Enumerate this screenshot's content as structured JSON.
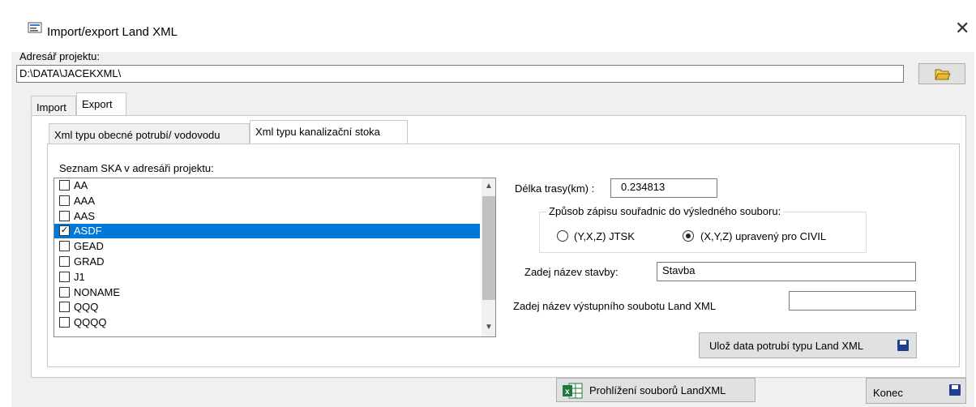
{
  "window": {
    "title": "Import/export Land XML",
    "close_symbol": "✕"
  },
  "project": {
    "dir_label": "Adresář projektu:",
    "dir_value": "D:\\DATA\\JACEKXML\\"
  },
  "main_tabs": {
    "import": "Import",
    "export": "Export"
  },
  "sub_tabs": {
    "general": "Xml typu obecné potrubí/ vodovodu",
    "sewer": "Xml typu kanalizační stoka"
  },
  "list": {
    "label": "Seznam SKA v adresáři projektu:",
    "items": [
      {
        "name": "AA",
        "checked": false,
        "selected": false
      },
      {
        "name": "AAA",
        "checked": false,
        "selected": false
      },
      {
        "name": "AAS",
        "checked": false,
        "selected": false
      },
      {
        "name": "ASDF",
        "checked": true,
        "selected": true
      },
      {
        "name": "GEAD",
        "checked": false,
        "selected": false
      },
      {
        "name": "GRAD",
        "checked": false,
        "selected": false
      },
      {
        "name": "J1",
        "checked": false,
        "selected": false
      },
      {
        "name": "NONAME",
        "checked": false,
        "selected": false
      },
      {
        "name": "QQQ",
        "checked": false,
        "selected": false
      },
      {
        "name": "QQQQ",
        "checked": false,
        "selected": false
      }
    ]
  },
  "route": {
    "label": "Délka trasy(km) :",
    "value": "0.234813"
  },
  "coords": {
    "group_label": "Způsob zápisu souřadnic do výsledného souboru:",
    "option_jtsk": "(Y,X,Z) JTSK",
    "option_civil": "(X,Y,Z) upravený pro CIVIL",
    "selected": "civil"
  },
  "building": {
    "label": "Zadej název stavby:",
    "value": "Stavba"
  },
  "output_file": {
    "label": "Zadej název výstupního soubotu Land XML",
    "value": ""
  },
  "buttons": {
    "save": "Ulož data potrubí typu Land XML",
    "browse": "Prohlížení souborů LandXML",
    "close": "Konec"
  },
  "colors": {
    "selection": "#0078d7",
    "floppy": "#1f3f8f",
    "folder": "#e8b830",
    "excel": "#1d7a3a"
  }
}
